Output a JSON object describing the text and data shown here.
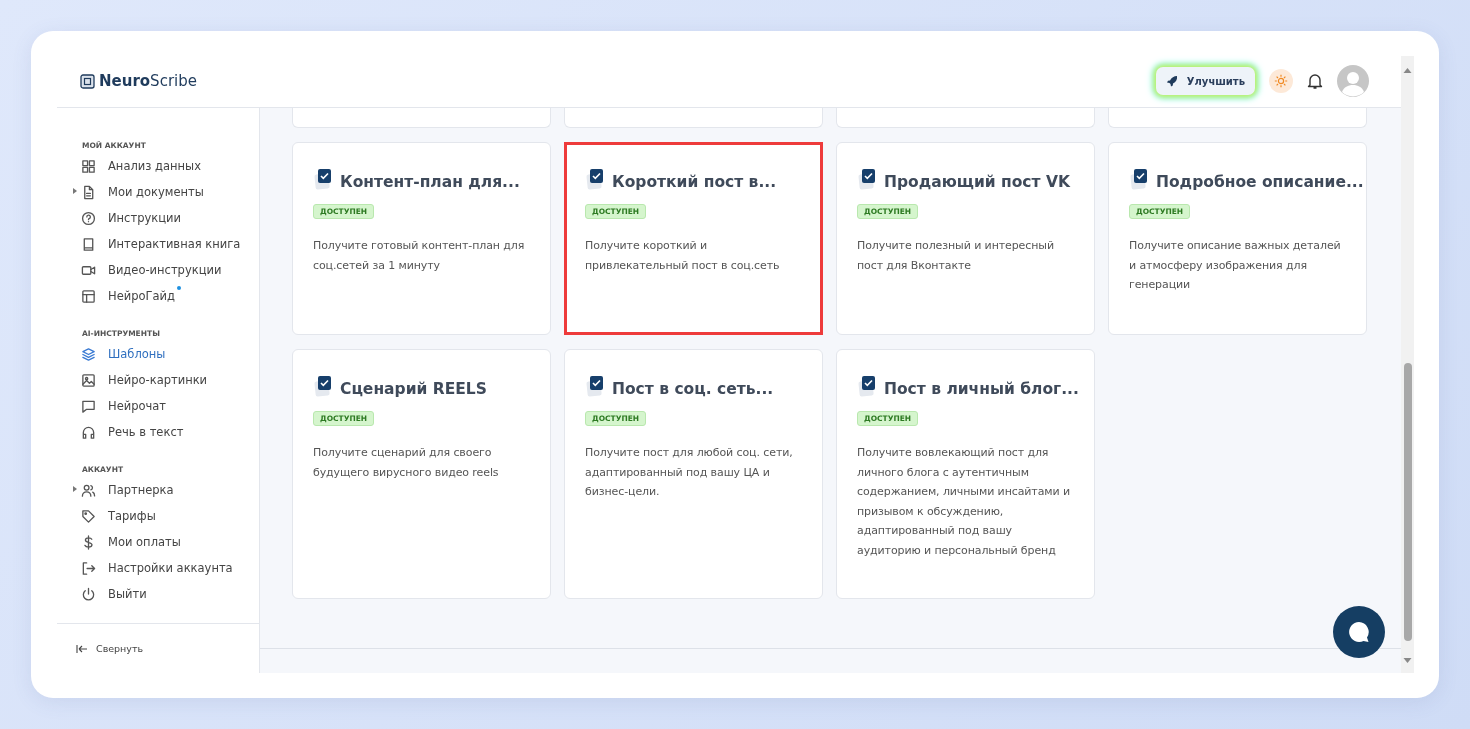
{
  "brand": {
    "strong": "Neuro",
    "light": "Scribe"
  },
  "header": {
    "upgrade_button": "Улучшить"
  },
  "sidebar": {
    "sections": [
      {
        "label": "МОЙ АККАУНТ",
        "items": [
          {
            "label": "Анализ данных",
            "selected": false,
            "expandable": false,
            "new_dot": false
          },
          {
            "label": "Мои документы",
            "selected": false,
            "expandable": true,
            "new_dot": false
          },
          {
            "label": "Инструкции",
            "selected": false,
            "expandable": false,
            "new_dot": false
          },
          {
            "label": "Интерактивная книга",
            "selected": false,
            "expandable": false,
            "new_dot": false
          },
          {
            "label": "Видео-инструкции",
            "selected": false,
            "expandable": false,
            "new_dot": false
          },
          {
            "label": "НейроГайд",
            "selected": false,
            "expandable": false,
            "new_dot": true
          }
        ]
      },
      {
        "label": "AI-ИНСТРУМЕНТЫ",
        "items": [
          {
            "label": "Шаблоны",
            "selected": true,
            "expandable": false,
            "new_dot": false
          },
          {
            "label": "Нейро-картинки",
            "selected": false,
            "expandable": false,
            "new_dot": false
          },
          {
            "label": "Нейрочат",
            "selected": false,
            "expandable": false,
            "new_dot": false
          },
          {
            "label": "Речь в текст",
            "selected": false,
            "expandable": false,
            "new_dot": false
          }
        ]
      },
      {
        "label": "АККАУНТ",
        "items": [
          {
            "label": "Партнерка",
            "selected": false,
            "expandable": true,
            "new_dot": false
          },
          {
            "label": "Тарифы",
            "selected": false,
            "expandable": false,
            "new_dot": false
          },
          {
            "label": "Мои оплаты",
            "selected": false,
            "expandable": false,
            "new_dot": false
          },
          {
            "label": "Настройки аккаунта",
            "selected": false,
            "expandable": false,
            "new_dot": false
          },
          {
            "label": "Выйти",
            "selected": false,
            "expandable": false,
            "new_dot": false
          }
        ]
      }
    ],
    "collapse_button": "Свернуть"
  },
  "cards": [
    {
      "title": "Контент-план для...",
      "badge": "ДОСТУПЕН",
      "description": "Получите готовый контент-план для соц.сетей за 1 минуту",
      "highlighted": false
    },
    {
      "title": "Короткий пост в...",
      "badge": "ДОСТУПЕН",
      "description": "Получите короткий и привлекательный пост в соц.сеть",
      "highlighted": true
    },
    {
      "title": "Продающий пост VK",
      "badge": "ДОСТУПЕН",
      "description": "Получите полезный и интересный пост для Вконтакте",
      "highlighted": false
    },
    {
      "title": "Подробное описание...",
      "badge": "ДОСТУПЕН",
      "description": "Получите описание важных деталей и атмосферу изображения для генерации",
      "highlighted": false
    },
    {
      "title": "Сценарий REELS",
      "badge": "ДОСТУПЕН",
      "description": "Получите сценарий для своего будущего вирусного видео reels",
      "highlighted": false
    },
    {
      "title": "Пост в соц. сеть...",
      "badge": "ДОСТУПЕН",
      "description": "Получите пост для любой соц. сети, адаптированный под вашу ЦА и бизнес-цели.",
      "highlighted": false
    },
    {
      "title": "Пост в личный блог...",
      "badge": "ДОСТУПЕН",
      "description": "Получите вовлекающий пост для личного блога с аутентичным содержанием, личными инсайтами и призывом к обсуждению, адаптированный под вашу аудиторию и персональный бренд",
      "highlighted": false
    }
  ]
}
